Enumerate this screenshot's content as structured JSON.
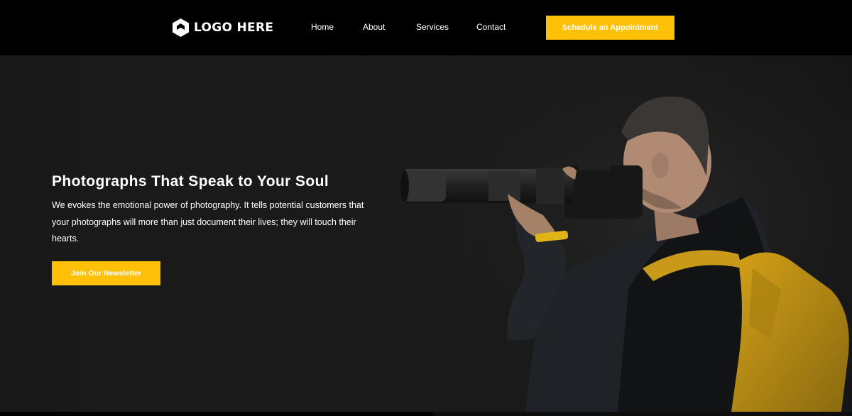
{
  "header": {
    "logo_text": "LOGO HERE",
    "nav": [
      "Home",
      "About",
      "Services",
      "Contact"
    ],
    "cta_label": "Schedule an Appointment"
  },
  "hero": {
    "title": "Photographs That Speak to Your Soul",
    "text": "We evokes the emotional power of photography. It tells potential customers that your photographs will more than just document their lives; they will touch their hearts.",
    "button_label": "Join Our Newsletter",
    "image_alt": "photographer with telephoto lens and yellow backpack"
  },
  "colors": {
    "accent": "#ffc107",
    "header_bg": "#000000",
    "hero_bg": "#1a1a1a",
    "text": "#ffffff"
  }
}
